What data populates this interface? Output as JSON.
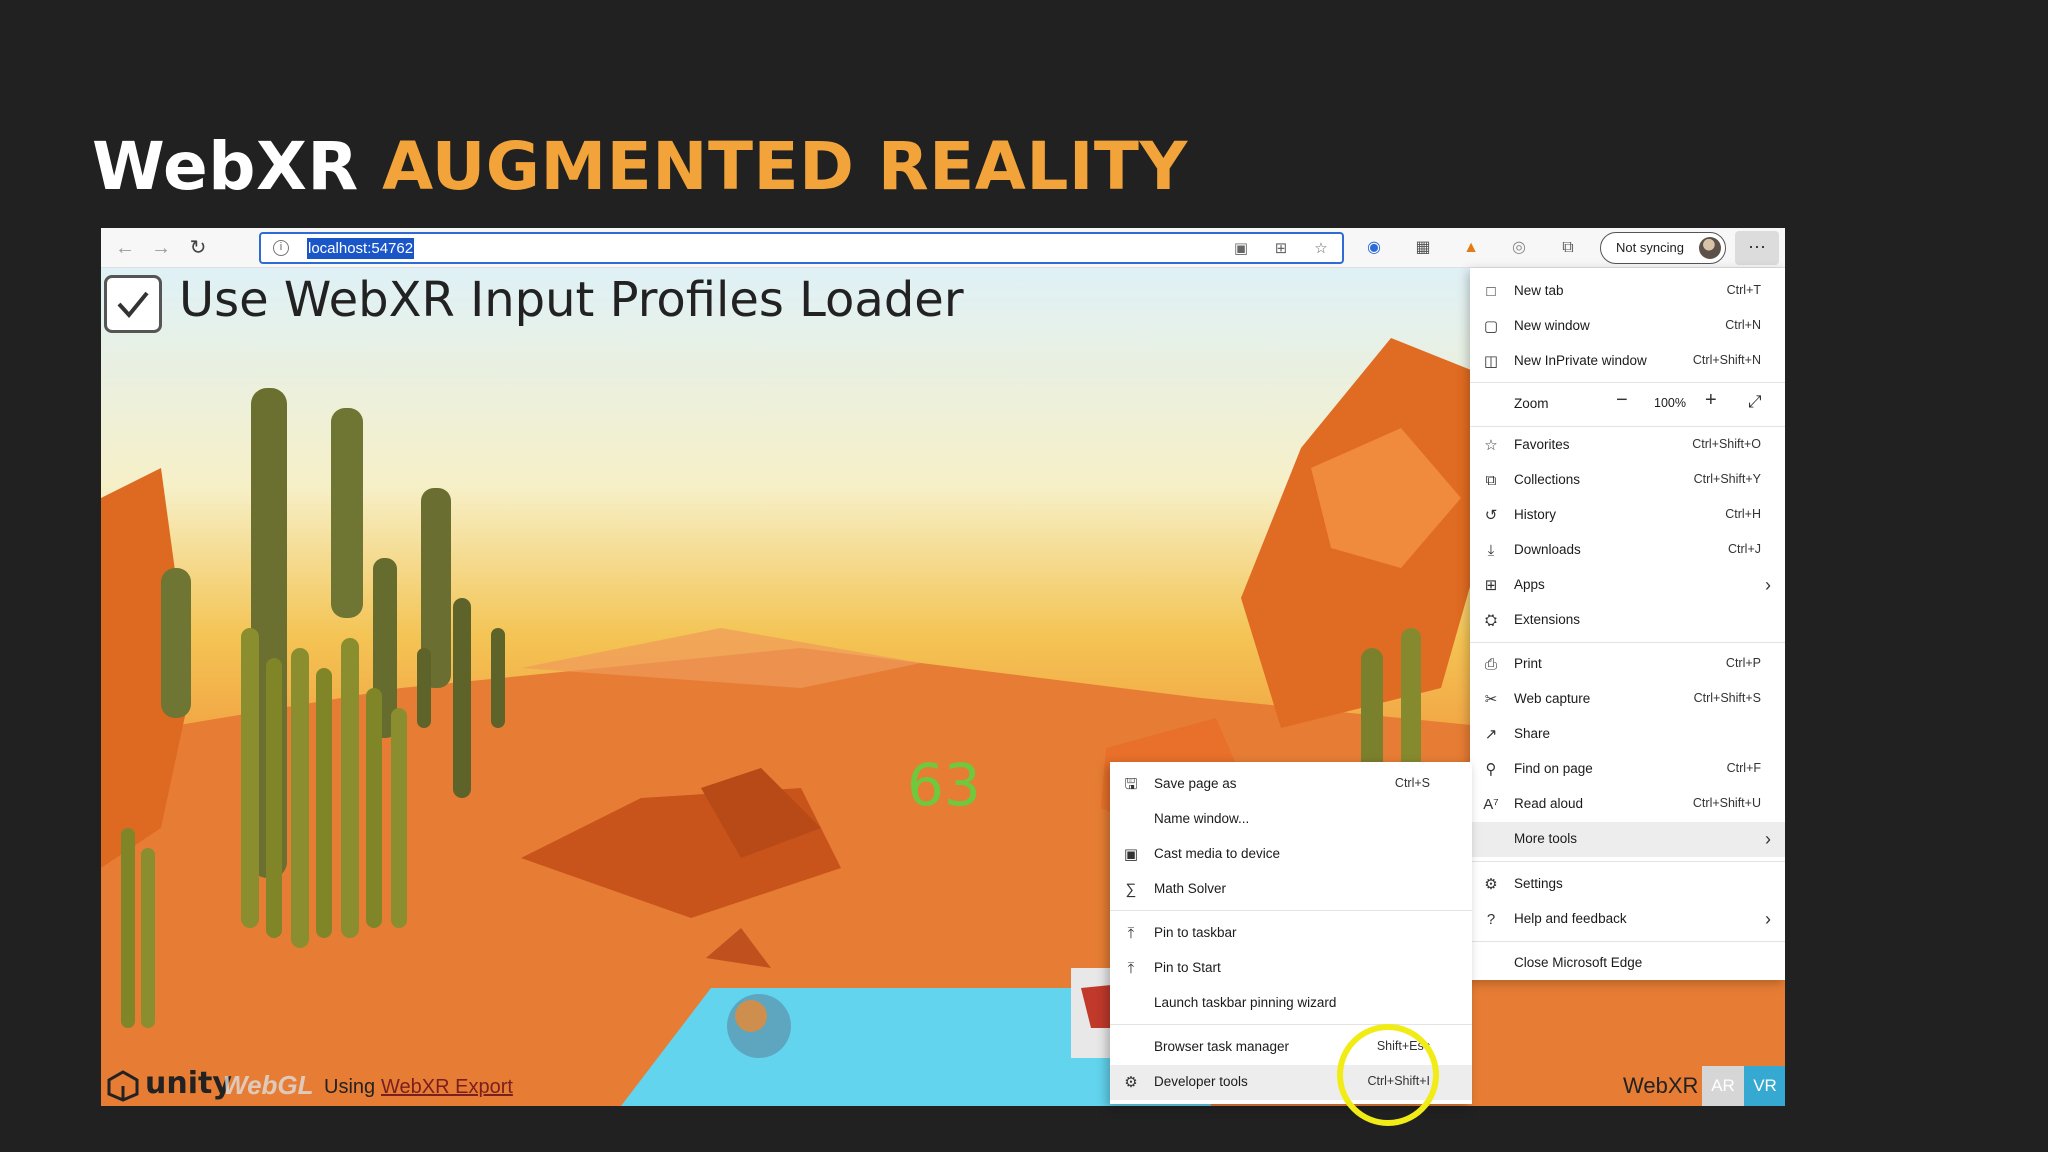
{
  "slide": {
    "title_white": "WebXR",
    "title_orange": "AUGMENTED REALITY"
  },
  "browser": {
    "address": "localhost:54762",
    "sync_label": "Not syncing",
    "more_label": "···"
  },
  "page": {
    "checkbox_label": "Use WebXR Input Profiles Loader",
    "fps": "63",
    "unity": "unity",
    "webgl": "WebGL",
    "using": "Using",
    "export_link": "WebXR Export",
    "webxr_label": "WebXR",
    "ar_button": "AR",
    "vr_button": "VR",
    "colors": {
      "ar": "#d6d6d6",
      "vr": "#35a9d2",
      "accent": "#f2a33a",
      "highlight_circle": "#f1ec16"
    }
  },
  "menu": {
    "new_tab": {
      "label": "New tab",
      "shortcut": "Ctrl+T"
    },
    "new_window": {
      "label": "New window",
      "shortcut": "Ctrl+N"
    },
    "inprivate": {
      "label": "New InPrivate window",
      "shortcut": "Ctrl+Shift+N"
    },
    "zoom": {
      "label": "Zoom",
      "value": "100%"
    },
    "favorites": {
      "label": "Favorites",
      "shortcut": "Ctrl+Shift+O"
    },
    "collections": {
      "label": "Collections",
      "shortcut": "Ctrl+Shift+Y"
    },
    "history": {
      "label": "History",
      "shortcut": "Ctrl+H"
    },
    "downloads": {
      "label": "Downloads",
      "shortcut": "Ctrl+J"
    },
    "apps": {
      "label": "Apps"
    },
    "extensions": {
      "label": "Extensions"
    },
    "print": {
      "label": "Print",
      "shortcut": "Ctrl+P"
    },
    "web_capture": {
      "label": "Web capture",
      "shortcut": "Ctrl+Shift+S"
    },
    "share": {
      "label": "Share"
    },
    "find": {
      "label": "Find on page",
      "shortcut": "Ctrl+F"
    },
    "read_aloud": {
      "label": "Read aloud",
      "shortcut": "Ctrl+Shift+U"
    },
    "more_tools": {
      "label": "More tools"
    },
    "settings": {
      "label": "Settings"
    },
    "help": {
      "label": "Help and feedback"
    },
    "close": {
      "label": "Close Microsoft Edge"
    }
  },
  "submenu": {
    "save_page": {
      "label": "Save page as",
      "shortcut": "Ctrl+S"
    },
    "name_window": {
      "label": "Name window..."
    },
    "cast": {
      "label": "Cast media to device"
    },
    "math": {
      "label": "Math Solver"
    },
    "pin_taskbar": {
      "label": "Pin to taskbar"
    },
    "pin_start": {
      "label": "Pin to Start"
    },
    "pin_wizard": {
      "label": "Launch taskbar pinning wizard"
    },
    "task_manager": {
      "label": "Browser task manager",
      "shortcut": "Shift+Esc"
    },
    "dev_tools": {
      "label": "Developer tools",
      "shortcut": "Ctrl+Shift+I"
    }
  }
}
